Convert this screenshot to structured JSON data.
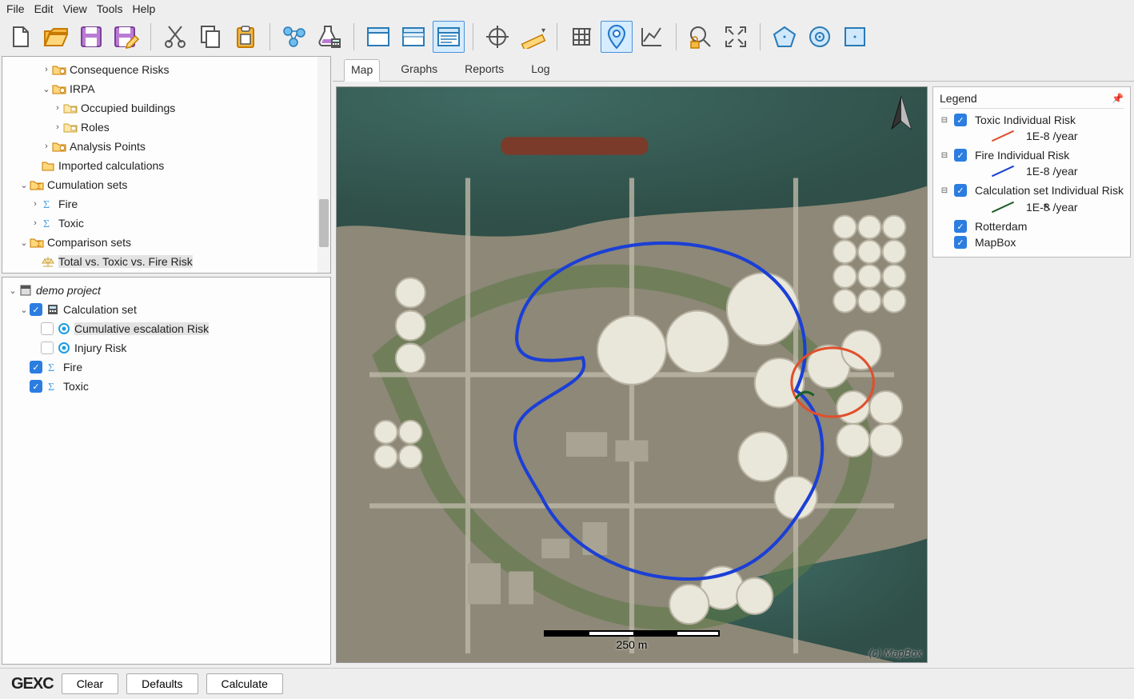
{
  "menu": {
    "file": "File",
    "edit": "Edit",
    "view": "View",
    "tools": "Tools",
    "help": "Help"
  },
  "tree_top": {
    "items": [
      {
        "indent": 3,
        "toggle": ">",
        "icon": "folder-risk",
        "label": "Consequence Risks"
      },
      {
        "indent": 3,
        "toggle": "v",
        "icon": "folder-risk",
        "label": "IRPA"
      },
      {
        "indent": 4,
        "toggle": ">",
        "icon": "folder-sub",
        "label": "Occupied buildings"
      },
      {
        "indent": 4,
        "toggle": ">",
        "icon": "folder-sub",
        "label": "Roles"
      },
      {
        "indent": 3,
        "toggle": ">",
        "icon": "folder-risk",
        "label": "Analysis Points"
      },
      {
        "indent": 2,
        "toggle": "",
        "icon": "folder",
        "label": "Imported calculations"
      },
      {
        "indent": 1,
        "toggle": "v",
        "icon": "folder-set",
        "label": "Cumulation sets"
      },
      {
        "indent": 2,
        "toggle": ">",
        "icon": "sigma",
        "label": "Fire"
      },
      {
        "indent": 2,
        "toggle": ">",
        "icon": "sigma",
        "label": "Toxic"
      },
      {
        "indent": 1,
        "toggle": "v",
        "icon": "folder-set",
        "label": "Comparison sets"
      },
      {
        "indent": 2,
        "toggle": "",
        "icon": "balance",
        "label": "Total vs. Toxic vs. Fire Risk",
        "selected": true
      }
    ]
  },
  "tree_bottom": {
    "items": [
      {
        "indent": 0,
        "toggle": "v",
        "icon": "project",
        "label": "demo project",
        "italic": true
      },
      {
        "indent": 1,
        "toggle": "v",
        "check": "on",
        "icon": "calc",
        "label": "Calculation set"
      },
      {
        "indent": 2,
        "toggle": "",
        "check": "off",
        "icon": "ring-blue",
        "label": "Cumulative escalation Risk",
        "selected": true
      },
      {
        "indent": 2,
        "toggle": "",
        "check": "off",
        "icon": "ring-blue",
        "label": "Injury Risk"
      },
      {
        "indent": 1,
        "toggle": "",
        "check": "on",
        "icon": "sigma",
        "label": "Fire"
      },
      {
        "indent": 1,
        "toggle": "",
        "check": "on",
        "icon": "sigma",
        "label": "Toxic"
      }
    ]
  },
  "tabs": {
    "map": "Map",
    "graphs": "Graphs",
    "reports": "Reports",
    "log": "Log"
  },
  "map": {
    "scale_label": "250 m",
    "attribution": "(c) MapBox"
  },
  "legend": {
    "title": "Legend",
    "entries": [
      {
        "name": "Toxic Individual Risk",
        "color": "#e0502c",
        "value": "1E-8 /year",
        "check": true,
        "expand": "⊟"
      },
      {
        "name": "Fire Individual Risk",
        "color": "#1b3fd6",
        "value": "1E-8 /year",
        "check": true,
        "expand": "⊟"
      },
      {
        "name": "Calculation set Individual Risk",
        "color": "#1e5e2a",
        "value": "1E-8 /year",
        "check": true,
        "expand": "⊟"
      }
    ],
    "layers": [
      {
        "name": "Rotterdam",
        "check": true
      },
      {
        "name": "MapBox",
        "check": true
      }
    ]
  },
  "status": {
    "logo": "GEXC",
    "clear": "Clear",
    "defaults": "Defaults",
    "calculate": "Calculate"
  },
  "colors": {
    "accent": "#2b7de0"
  }
}
